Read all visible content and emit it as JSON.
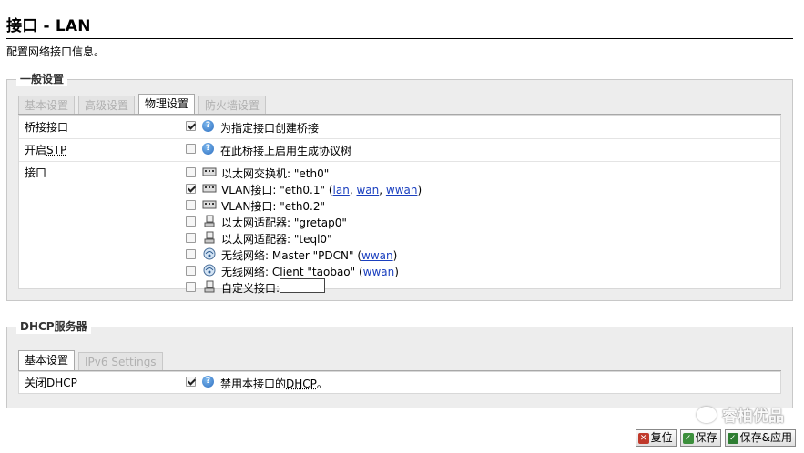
{
  "page": {
    "title": "接口 - LAN",
    "description": "配置网络接口信息。"
  },
  "general": {
    "legend": "一般设置",
    "tabs": [
      {
        "label": "基本设置",
        "active": false
      },
      {
        "label": "高级设置",
        "active": false
      },
      {
        "label": "物理设置",
        "active": true
      },
      {
        "label": "防火墙设置",
        "active": false
      }
    ],
    "bridge": {
      "label": "桥接接口",
      "checked": true,
      "help": "为指定接口创建桥接"
    },
    "stp": {
      "label_prefix": "开启",
      "label_abbr": "STP",
      "checked": false,
      "help": "在此桥接上启用生成协议树"
    },
    "interfaces": {
      "label": "接口",
      "items": [
        {
          "text": "以太网交换机: \"eth0\"",
          "checked": false,
          "icon": "switch-icon",
          "links": []
        },
        {
          "text": "VLAN接口: \"eth0.1\" (",
          "checked": true,
          "icon": "switch-icon",
          "links": [
            "lan",
            "wan",
            "wwan"
          ],
          "suffix": ")"
        },
        {
          "text": "VLAN接口: \"eth0.2\"",
          "checked": false,
          "icon": "switch-icon",
          "links": []
        },
        {
          "text": "以太网适配器: \"gretap0\"",
          "checked": false,
          "icon": "ethernet-icon",
          "links": []
        },
        {
          "text": "以太网适配器: \"teql0\"",
          "checked": false,
          "icon": "ethernet-icon",
          "links": []
        },
        {
          "text": "无线网络: Master \"PDCN\" (",
          "checked": false,
          "icon": "wifi-icon",
          "links": [
            "wwan"
          ],
          "suffix": ")"
        },
        {
          "text": "无线网络: Client \"taobao\" (",
          "checked": false,
          "icon": "wifi-icon",
          "links": [
            "wwan"
          ],
          "suffix": ")"
        }
      ],
      "custom": {
        "label": "自定义接口:",
        "value": ""
      }
    }
  },
  "dhcp": {
    "legend": "DHCP服务器",
    "tabs": [
      {
        "label": "基本设置",
        "active": true
      },
      {
        "label": "IPv6 Settings",
        "active": false
      }
    ],
    "disable": {
      "label": "关闭DHCP",
      "checked": true,
      "help_prefix": "禁用本接口的",
      "help_abbr": "DHCP",
      "help_suffix": "。"
    }
  },
  "buttons": {
    "reset": "复位",
    "save": "保存",
    "save_apply": "保存&应用"
  },
  "watermark": {
    "text": "睿柏优品"
  }
}
